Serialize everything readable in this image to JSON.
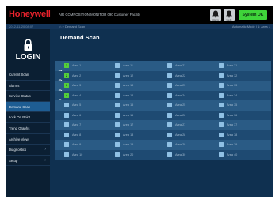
{
  "brand": {
    "logo": "Honeywell",
    "facility_text": "AIR COMPOSITION MONITOR 090 Customer Facility"
  },
  "topbar": {
    "icons": [
      {
        "name": "bell-icon",
        "caption": "Alarms"
      },
      {
        "name": "bell-icon",
        "caption": "Faults"
      }
    ],
    "status_label": "System OK",
    "status_color": "#3fd43a"
  },
  "subbar": {
    "datetime": "2012-11-20 08:07",
    "breadcrumb": "» Demand Scan",
    "mode": "Automatic Mode | 1: Area 1"
  },
  "sidebar": {
    "login_label": "LOGIN",
    "items": [
      {
        "label": "Current Scan",
        "active": false,
        "has_arrow": false
      },
      {
        "label": "Alarms",
        "active": false,
        "has_arrow": false
      },
      {
        "label": "Service Status",
        "active": false,
        "has_arrow": false
      },
      {
        "label": "Demand Scan",
        "active": true,
        "has_arrow": false
      },
      {
        "label": "Lock On Point",
        "active": false,
        "has_arrow": false
      },
      {
        "label": "Trend Graphs",
        "active": false,
        "has_arrow": false
      },
      {
        "label": "Archive View",
        "active": false,
        "has_arrow": false
      },
      {
        "label": "Diagnostics",
        "active": false,
        "has_arrow": true
      },
      {
        "label": "Setup",
        "active": false,
        "has_arrow": true
      }
    ]
  },
  "main": {
    "title": "Demand Scan",
    "rows": [
      {
        "gear": true,
        "cells": [
          {
            "num": "1",
            "label": "Area 1",
            "selected": true
          },
          {
            "label": "Area 11"
          },
          {
            "label": "Area 21"
          },
          {
            "label": "Area 31"
          }
        ]
      },
      {
        "gear": true,
        "cells": [
          {
            "num": "2",
            "label": "Area 2",
            "selected": true
          },
          {
            "label": "Area 12"
          },
          {
            "label": "Area 22"
          },
          {
            "label": "Area 32"
          }
        ]
      },
      {
        "gear": true,
        "cells": [
          {
            "num": "3",
            "label": "Area 3",
            "selected": true
          },
          {
            "label": "Area 13"
          },
          {
            "label": "Area 23"
          },
          {
            "label": "Area 33"
          }
        ]
      },
      {
        "gear": true,
        "cells": [
          {
            "num": "4",
            "label": "Area 4",
            "selected": true
          },
          {
            "label": "Area 14"
          },
          {
            "label": "Area 24"
          },
          {
            "label": "Area 34"
          }
        ]
      },
      {
        "gear": false,
        "cells": [
          {
            "label": "Area 5"
          },
          {
            "label": "Area 15"
          },
          {
            "label": "Area 25"
          },
          {
            "label": "Area 35"
          }
        ]
      },
      {
        "gear": false,
        "cells": [
          {
            "label": "Area 6"
          },
          {
            "label": "Area 16"
          },
          {
            "label": "Area 26"
          },
          {
            "label": "Area 36"
          }
        ]
      },
      {
        "gear": false,
        "cells": [
          {
            "label": "Area 7"
          },
          {
            "label": "Area 17"
          },
          {
            "label": "Area 27"
          },
          {
            "label": "Area 37"
          }
        ]
      },
      {
        "gear": false,
        "cells": [
          {
            "label": "Area 8"
          },
          {
            "label": "Area 18"
          },
          {
            "label": "Area 28"
          },
          {
            "label": "Area 38"
          }
        ]
      },
      {
        "gear": false,
        "cells": [
          {
            "label": "Area 9"
          },
          {
            "label": "Area 19"
          },
          {
            "label": "Area 29"
          },
          {
            "label": "Area 39"
          }
        ]
      },
      {
        "gear": false,
        "cells": [
          {
            "label": "Area 10"
          },
          {
            "label": "Area 20"
          },
          {
            "label": "Area 30"
          },
          {
            "label": "Area 40"
          }
        ]
      }
    ]
  }
}
